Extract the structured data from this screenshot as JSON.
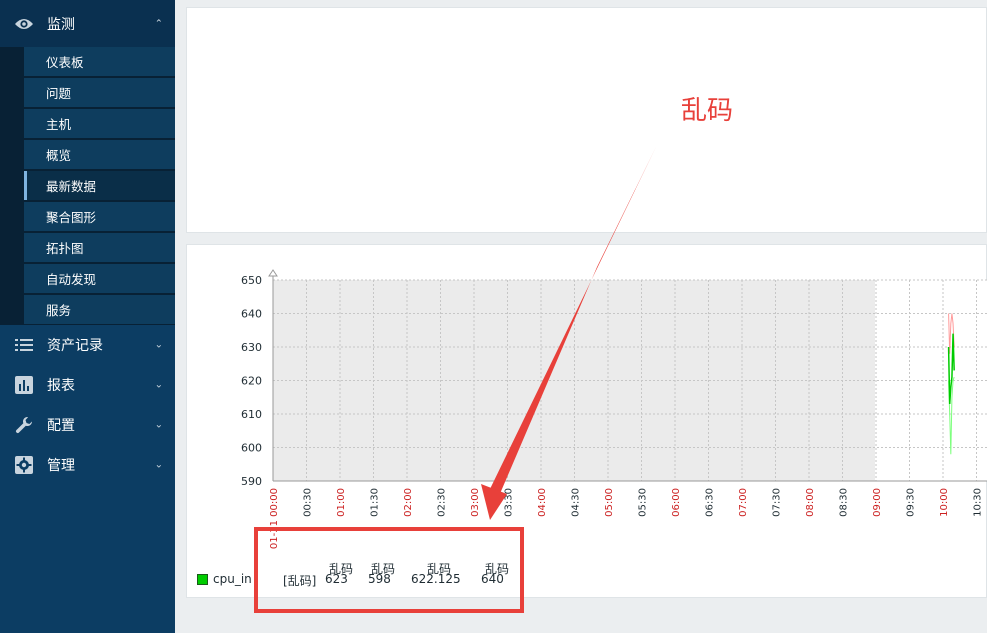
{
  "sidebar": {
    "monitor": {
      "label": "监测",
      "icon": "eye-icon"
    },
    "items": [
      {
        "label": "仪表板"
      },
      {
        "label": "问题"
      },
      {
        "label": "主机"
      },
      {
        "label": "概览"
      },
      {
        "label": "最新数据",
        "current": true
      },
      {
        "label": "聚合图形"
      },
      {
        "label": "拓扑图"
      },
      {
        "label": "自动发现"
      },
      {
        "label": "服务"
      }
    ],
    "sections": [
      {
        "label": "资产记录",
        "icon": "list-icon"
      },
      {
        "label": "报表",
        "icon": "bar-chart-icon"
      },
      {
        "label": "配置",
        "icon": "wrench-icon"
      },
      {
        "label": "管理",
        "icon": "gear-icon"
      }
    ]
  },
  "chart_data": {
    "type": "line",
    "y_ticks": [
      "650",
      "640",
      "630",
      "620",
      "610",
      "600",
      "590"
    ],
    "ylim": [
      590,
      650
    ],
    "x_ticks": [
      "01-31 00:00",
      "00:30",
      "01:00",
      "01:30",
      "02:00",
      "02:30",
      "03:00",
      "03:30",
      "04:00",
      "04:30",
      "05:00",
      "05:30",
      "06:00",
      "06:30",
      "07:00",
      "07:30",
      "08:00",
      "08:30",
      "09:00",
      "09:30",
      "10:00",
      "10:30"
    ],
    "x_red_ticks": [
      "01-31 00:00",
      "01:00",
      "02:00",
      "03:00",
      "04:00",
      "05:00",
      "06:00",
      "07:00",
      "08:00",
      "09:00",
      "10:00"
    ],
    "series": [
      {
        "name": "cpu_in",
        "color": "#00cc00",
        "x": [
          "10:05",
          "10:06",
          "10:07",
          "10:08",
          "10:09",
          "10:10"
        ],
        "avg": [
          630,
          613,
          618,
          621,
          634,
          623
        ],
        "min": [
          620,
          610,
          598,
          615,
          620,
          621
        ],
        "max": [
          640,
          628,
          637,
          640,
          637,
          630
        ]
      }
    ],
    "legend": {
      "series_label": "cpu_in",
      "func_label": "[乱码]",
      "headers": [
        "乱码",
        "乱码",
        "乱码",
        "乱码"
      ],
      "values": [
        "623",
        "598",
        "622.125",
        "640"
      ]
    }
  },
  "annotation": {
    "text": "乱码"
  },
  "colors": {
    "sidebar": "#0c3d63",
    "annotation": "#e8403a",
    "series": "#00cc00"
  }
}
